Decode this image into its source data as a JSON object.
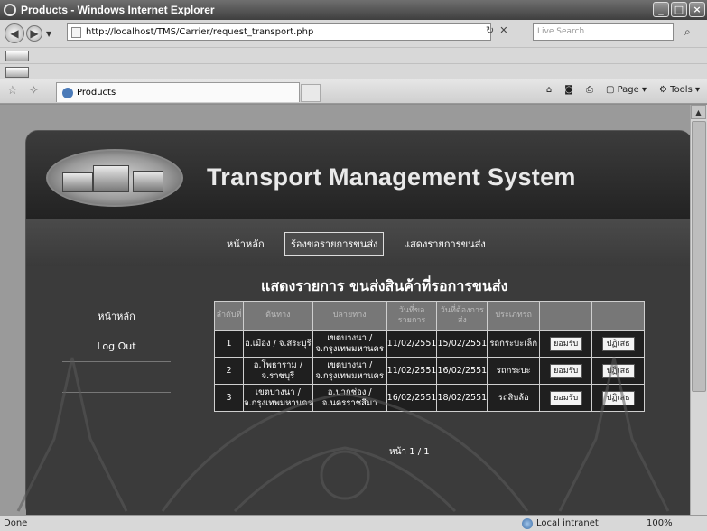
{
  "window": {
    "title": "Products - Windows Internet Explorer",
    "buttons": [
      "_",
      "□",
      "×"
    ]
  },
  "address_bar": {
    "url": "http://localhost/TMS/Carrier/request_transport.php",
    "search_placeholder": "Live Search"
  },
  "tab": {
    "title": "Products"
  },
  "command_bar": {
    "page_label": "Page",
    "tools_label": "Tools"
  },
  "site": {
    "title": "Transport Management System",
    "top_nav": [
      "หน้าหลัก",
      "ร้องขอรายการขนส่ง",
      "แสดงรายการขนส่ง"
    ],
    "left_nav": [
      "หน้าหลัก",
      "Log Out"
    ],
    "heading": "แสดงรายการ ขนส่งสินค้าที่รอการขนส่ง",
    "table": {
      "headers": [
        "ลำดับที่",
        "ต้นทาง",
        "ปลายทาง",
        "วันที่ขอรายการ",
        "วันที่ต้องการส่ง",
        "ประเภทรถ",
        "",
        ""
      ],
      "rows": [
        {
          "no": "1",
          "origin": "อ.เมือง / จ.สระบุรี",
          "dest": "เขตบางนา / จ.กรุงเทพมหานคร",
          "req": "11/02/2551",
          "need": "15/02/2551",
          "type": "รถกระบะเล็ก",
          "accept": "ยอมรับ",
          "reject": "ปฏิเสธ"
        },
        {
          "no": "2",
          "origin": "อ.โพธาราม / จ.ราชบุรี",
          "dest": "เขตบางนา / จ.กรุงเทพมหานคร",
          "req": "11/02/2551",
          "need": "16/02/2551",
          "type": "รถกระบะ",
          "accept": "ยอมรับ",
          "reject": "ปฏิเสธ"
        },
        {
          "no": "3",
          "origin": "เขตบางนา / จ.กรุงเทพมหานคร",
          "dest": "อ.ปากช่อง / จ.นครราชสีมา",
          "req": "16/02/2551",
          "need": "18/02/2551",
          "type": "รถสิบล้อ",
          "accept": "ยอมรับ",
          "reject": "ปฏิเสธ"
        }
      ]
    },
    "pager": "หน้า 1 / 1"
  },
  "status_bar": {
    "status": "Done",
    "zone": "Local intranet",
    "zoom": "100%"
  }
}
